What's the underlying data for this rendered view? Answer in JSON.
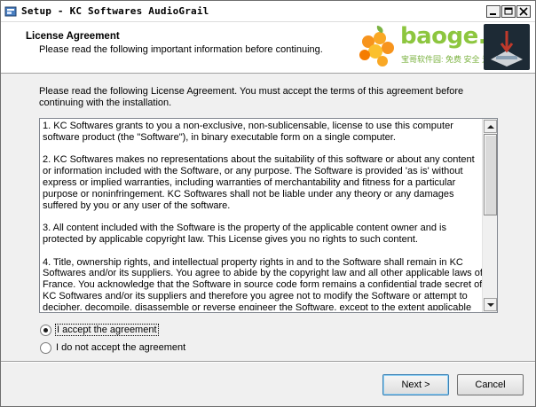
{
  "window": {
    "title": "Setup - KC Softwares AudioGrail"
  },
  "header": {
    "title": "License Agreement",
    "subtitle": "Please read the following important information before continuing."
  },
  "watermark": {
    "word": "baoge.net",
    "tagline": "宝哥软件园: 免费 安全 无毒"
  },
  "intro_text": "Please read the following License Agreement. You must accept the terms of this agreement before continuing with the installation.",
  "license": {
    "paragraphs": [
      "1. KC Softwares grants to you a non-exclusive, non-sublicensable, license to use this computer software product (the \"Software\"), in binary executable form on a single computer.",
      "2. KC Softwares makes no representations about the suitability of this software or about any content or information included with the Software, or any purpose.  The Software is provided 'as is' without express or implied warranties, including warranties of merchantability and fitness for a particular purpose or noninfringement.  KC Softwares shall not be liable under any theory or any damages suffered by you or any user of the software.",
      "3. All content included with the Software is the property of the applicable content owner and is protected by applicable copyright law. This License gives you no rights to such content.",
      "4. Title, ownership rights, and intellectual property rights in and to the Software shall remain in KC Softwares and/or its suppliers. You agree to abide by the copyright law and all other applicable laws of France. You acknowledge that the Software in source code form remains a confidential trade secret of KC Softwares and/or its suppliers and therefore you agree not to modify the Software or attempt to decipher, decompile, disassemble or reverse engineer the Software, except to the extent applicable"
    ]
  },
  "options": {
    "accept_label": "I accept the agreement",
    "decline_label": "I do not accept the agreement",
    "selected": "accept"
  },
  "buttons": {
    "next_label": "Next >",
    "cancel_label": "Cancel"
  },
  "colors": {
    "watermark_green": "#8dc63f",
    "dialog_bg": "#f0f0f0"
  }
}
